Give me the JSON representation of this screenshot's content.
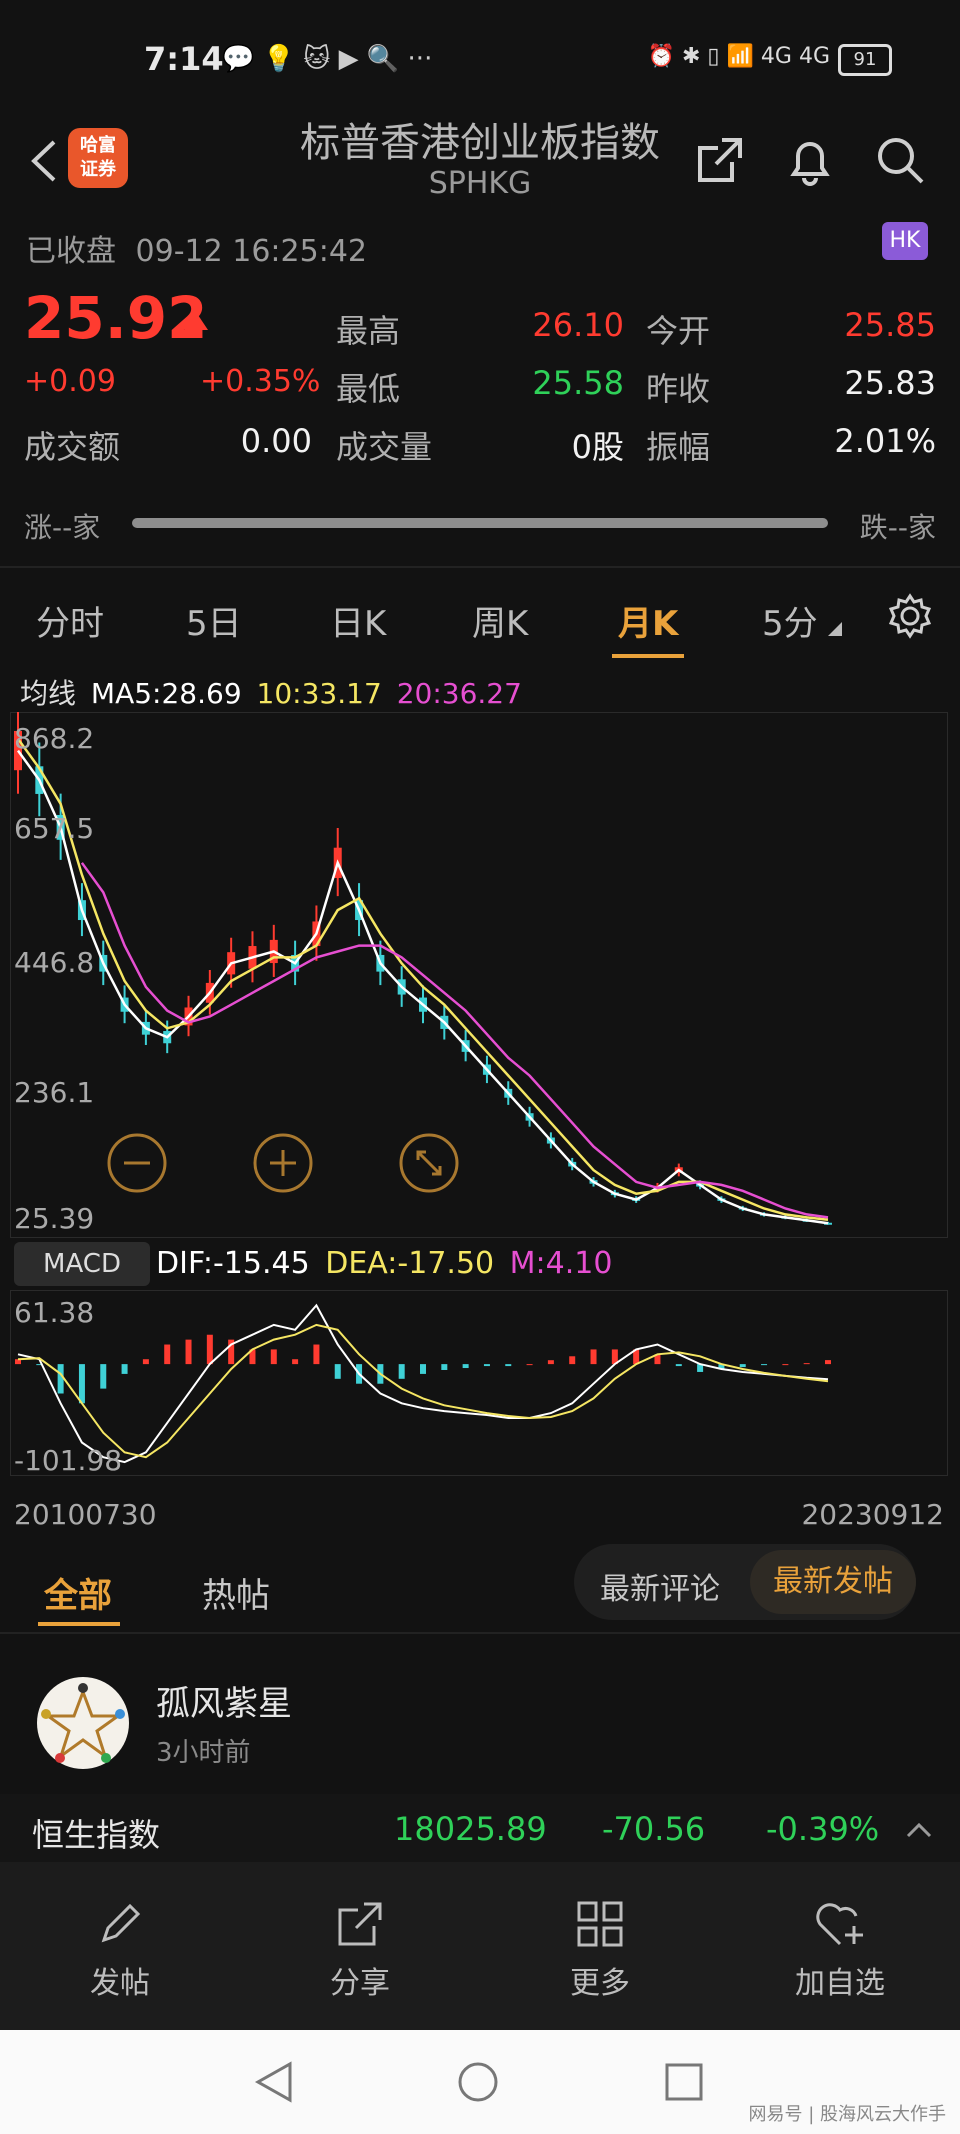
{
  "status_bar": {
    "time": "7:14",
    "apps": "💬 💡 🐱 ▶ 🔍 ···",
    "indicators": "⏰ ✱ ▯ 📶 4G 4G",
    "battery": "91"
  },
  "header": {
    "title": "标普香港创业板指数",
    "code": "SPHKG",
    "broker_logo": "哈富\n证券"
  },
  "market_status": {
    "state": "已收盘",
    "datetime": "09-12 16:25:42",
    "market_badge": "HK"
  },
  "quote": {
    "price": "25.92",
    "change": "+0.09",
    "change_pct": "+0.35%",
    "high_label": "最高",
    "high": "26.10",
    "low_label": "最低",
    "low": "25.58",
    "open_label": "今开",
    "open": "25.85",
    "prev_close_label": "昨收",
    "prev_close": "25.83",
    "turnover_label": "成交额",
    "turnover": "0.00",
    "volume_label": "成交量",
    "volume": "0股",
    "amplitude_label": "振幅",
    "amplitude": "2.01%",
    "rise_label": "涨--家",
    "fall_label": "跌--家"
  },
  "chart_tabs": [
    "分时",
    "5日",
    "日K",
    "周K",
    "月K",
    "5分"
  ],
  "active_tab": "月K",
  "ma_legend": {
    "label": "均线",
    "ma5": "MA5:28.69",
    "ma10": "10:33.17",
    "ma20": "20:36.27"
  },
  "macd_legend": {
    "label": "MACD",
    "dif": "DIF:-15.45",
    "dea": "DEA:-17.50",
    "m": "M:4.10"
  },
  "colors": {
    "up": "#ff3b30",
    "down": "#2fd159",
    "ma5": "#ffffff",
    "ma10": "#f5e663",
    "ma20": "#e64fd1",
    "accent": "#e9a23b",
    "bg": "#121212"
  },
  "chart_data": [
    {
      "type": "line",
      "title": "",
      "y_ticks": [
        "868.2",
        "657.5",
        "446.8",
        "236.1",
        "25.39"
      ],
      "ylim": [
        25.39,
        868.2
      ],
      "x_labels": [
        "20100730",
        "20230912"
      ],
      "series": [
        {
          "name": "MA5",
          "values": [
            830,
            780,
            700,
            560,
            470,
            400,
            360,
            345,
            380,
            420,
            470,
            480,
            490,
            470,
            520,
            640,
            560,
            470,
            430,
            400,
            370,
            330,
            290,
            250,
            210,
            170,
            130,
            100,
            80,
            70,
            90,
            120,
            95,
            70,
            55,
            45,
            40,
            35,
            30
          ]
        },
        {
          "name": "10",
          "values": [
            850,
            800,
            740,
            620,
            520,
            440,
            390,
            360,
            370,
            400,
            440,
            460,
            480,
            480,
            500,
            560,
            580,
            520,
            470,
            430,
            400,
            360,
            320,
            280,
            240,
            200,
            160,
            120,
            95,
            80,
            85,
            100,
            100,
            85,
            70,
            55,
            45,
            40,
            36
          ]
        },
        {
          "name": "20",
          "values": [
            null,
            null,
            null,
            640,
            590,
            500,
            430,
            390,
            370,
            380,
            400,
            420,
            440,
            460,
            480,
            490,
            500,
            500,
            480,
            450,
            420,
            390,
            350,
            310,
            280,
            240,
            200,
            160,
            130,
            100,
            90,
            95,
            100,
            95,
            85,
            70,
            55,
            45,
            40
          ]
        }
      ]
    },
    {
      "type": "bar",
      "title": "",
      "y_ticks": [
        "61.38",
        "-101.98"
      ],
      "ylim": [
        -101.98,
        61.38
      ],
      "series": [
        {
          "name": "DIF",
          "values": [
            10,
            5,
            -40,
            -80,
            -95,
            -100,
            -90,
            -60,
            -30,
            0,
            20,
            30,
            40,
            35,
            60,
            20,
            -10,
            -30,
            -40,
            -45,
            -48,
            -50,
            -52,
            -55,
            -55,
            -50,
            -40,
            -20,
            0,
            15,
            20,
            10,
            0,
            -5,
            -8,
            -10,
            -12,
            -14,
            -15.45
          ]
        },
        {
          "name": "DEA",
          "values": [
            5,
            6,
            -10,
            -40,
            -70,
            -90,
            -95,
            -80,
            -55,
            -30,
            -5,
            15,
            25,
            30,
            40,
            35,
            10,
            -10,
            -25,
            -35,
            -42,
            -46,
            -50,
            -53,
            -55,
            -54,
            -48,
            -35,
            -15,
            0,
            10,
            12,
            8,
            0,
            -5,
            -9,
            -12,
            -15,
            -17.5
          ]
        },
        {
          "name": "M",
          "values": [
            5,
            -1,
            -30,
            -40,
            -25,
            -10,
            5,
            20,
            25,
            30,
            25,
            15,
            15,
            5,
            20,
            -15,
            -20,
            -20,
            -15,
            -10,
            -6,
            -4,
            -2,
            -2,
            0,
            4,
            8,
            15,
            15,
            15,
            10,
            -2,
            -8,
            -5,
            -3,
            -1,
            0,
            1,
            4.1
          ]
        }
      ]
    }
  ],
  "posts": {
    "tabs": [
      "全部",
      "热帖"
    ],
    "active_tab": "全部",
    "sort_options": [
      "最新评论",
      "最新发帖"
    ],
    "active_sort": "最新发帖",
    "first_post": {
      "author": "孤风紫星",
      "time": "3小时前"
    }
  },
  "ticker": {
    "name": "恒生指数",
    "value": "18025.89",
    "change": "-70.56",
    "change_pct": "-0.39%"
  },
  "bottom_nav": [
    {
      "label": "发帖",
      "icon": "pencil-icon"
    },
    {
      "label": "分享",
      "icon": "share-icon"
    },
    {
      "label": "更多",
      "icon": "grid-icon"
    },
    {
      "label": "加自选",
      "icon": "heart-plus-icon"
    }
  ],
  "watermark": "网易号 | 股海风云大作手"
}
